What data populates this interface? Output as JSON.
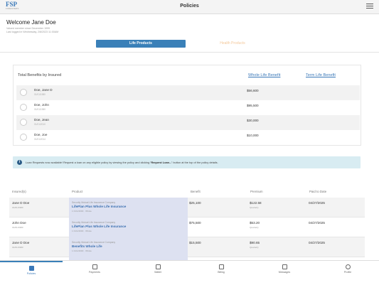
{
  "app": {
    "title": "Policies",
    "logo_text": "FSP",
    "logo_subtext": "FORESTERS"
  },
  "welcome": {
    "heading": "Welcome Jane Doe",
    "valued_member": "Valued member since December 1999",
    "last_login": "Last logged in Wednesday, 2/8/2023 11:00AM"
  },
  "tabs": [
    {
      "label": "Life Products",
      "active": true
    },
    {
      "label": "Health Products",
      "active": false
    }
  ],
  "benefits": {
    "title": "Total Benefits by Insured",
    "col_whole": "Whole Life Benefit",
    "col_term": "Term Life Benefit",
    "rows": [
      {
        "name": "Doe, Jane D",
        "date": "01/01/1980",
        "whole": "$56,600"
      },
      {
        "name": "Doe, John",
        "date": "01/01/1980",
        "whole": "$95,500"
      },
      {
        "name": "Doe, Jean",
        "date": "01/01/2010",
        "whole": "$30,000"
      },
      {
        "name": "Doe, Joe",
        "date": "01/01/2014",
        "whole": "$10,000"
      }
    ]
  },
  "notice": {
    "text_before": "Loan Requests now available! Request a loan on any eligible policy by viewing the policy and clicking ",
    "text_bold": "'Request Loan...'",
    "text_after": " button at the top of the policy details."
  },
  "policies": {
    "headers": [
      "Insured(s)",
      "Product",
      "Benefit",
      "Premium",
      "Paid to Date"
    ],
    "rows": [
      {
        "insured": "Jane D Doe",
        "insured_date": "01/01/1980",
        "company": "Security Mutual Life Insurance Company",
        "product": "LifePlan Plus Whole Life Insurance",
        "meta": "1 01/1/2000 · Whole",
        "benefit": "$25,100",
        "premium": "$122.58",
        "freq": "Quarterly",
        "paid": "04/27/2025"
      },
      {
        "insured": "John Doe",
        "insured_date": "01/01/1980",
        "company": "Security Mutual Life Insurance Company",
        "product": "LifePlan Plus Whole Life Insurance",
        "meta": "1 01/1/2000 · Whole",
        "benefit": "$75,500",
        "premium": "$53.20",
        "freq": "Quarterly",
        "paid": "04/27/2025"
      },
      {
        "insured": "Jane D Doe",
        "insured_date": "01/01/1980",
        "company": "Security Mutual Life Insurance Company",
        "product": "Benefits Whole Life",
        "meta": "1 01/1/2000 · Whole",
        "benefit": "$15,500",
        "premium": "$90.65",
        "freq": "Quarterly",
        "paid": "04/27/2025"
      }
    ]
  },
  "nav": [
    {
      "label": "Policies",
      "icon": "document-icon",
      "active": true
    },
    {
      "label": "Payments",
      "icon": "payment-icon",
      "active": false
    },
    {
      "label": "Wallet",
      "icon": "wallet-icon",
      "active": false
    },
    {
      "label": "Billing",
      "icon": "calendar-icon",
      "active": false
    },
    {
      "label": "Messages",
      "icon": "mail-icon",
      "active": false
    },
    {
      "label": "Profile",
      "icon": "profile-icon",
      "active": false
    }
  ],
  "colors": {
    "accent": "#3a80b8",
    "notice_bg": "#d8ecf2",
    "product_bg": "#dde1f1",
    "inactive_tab": "#f3c89a"
  }
}
